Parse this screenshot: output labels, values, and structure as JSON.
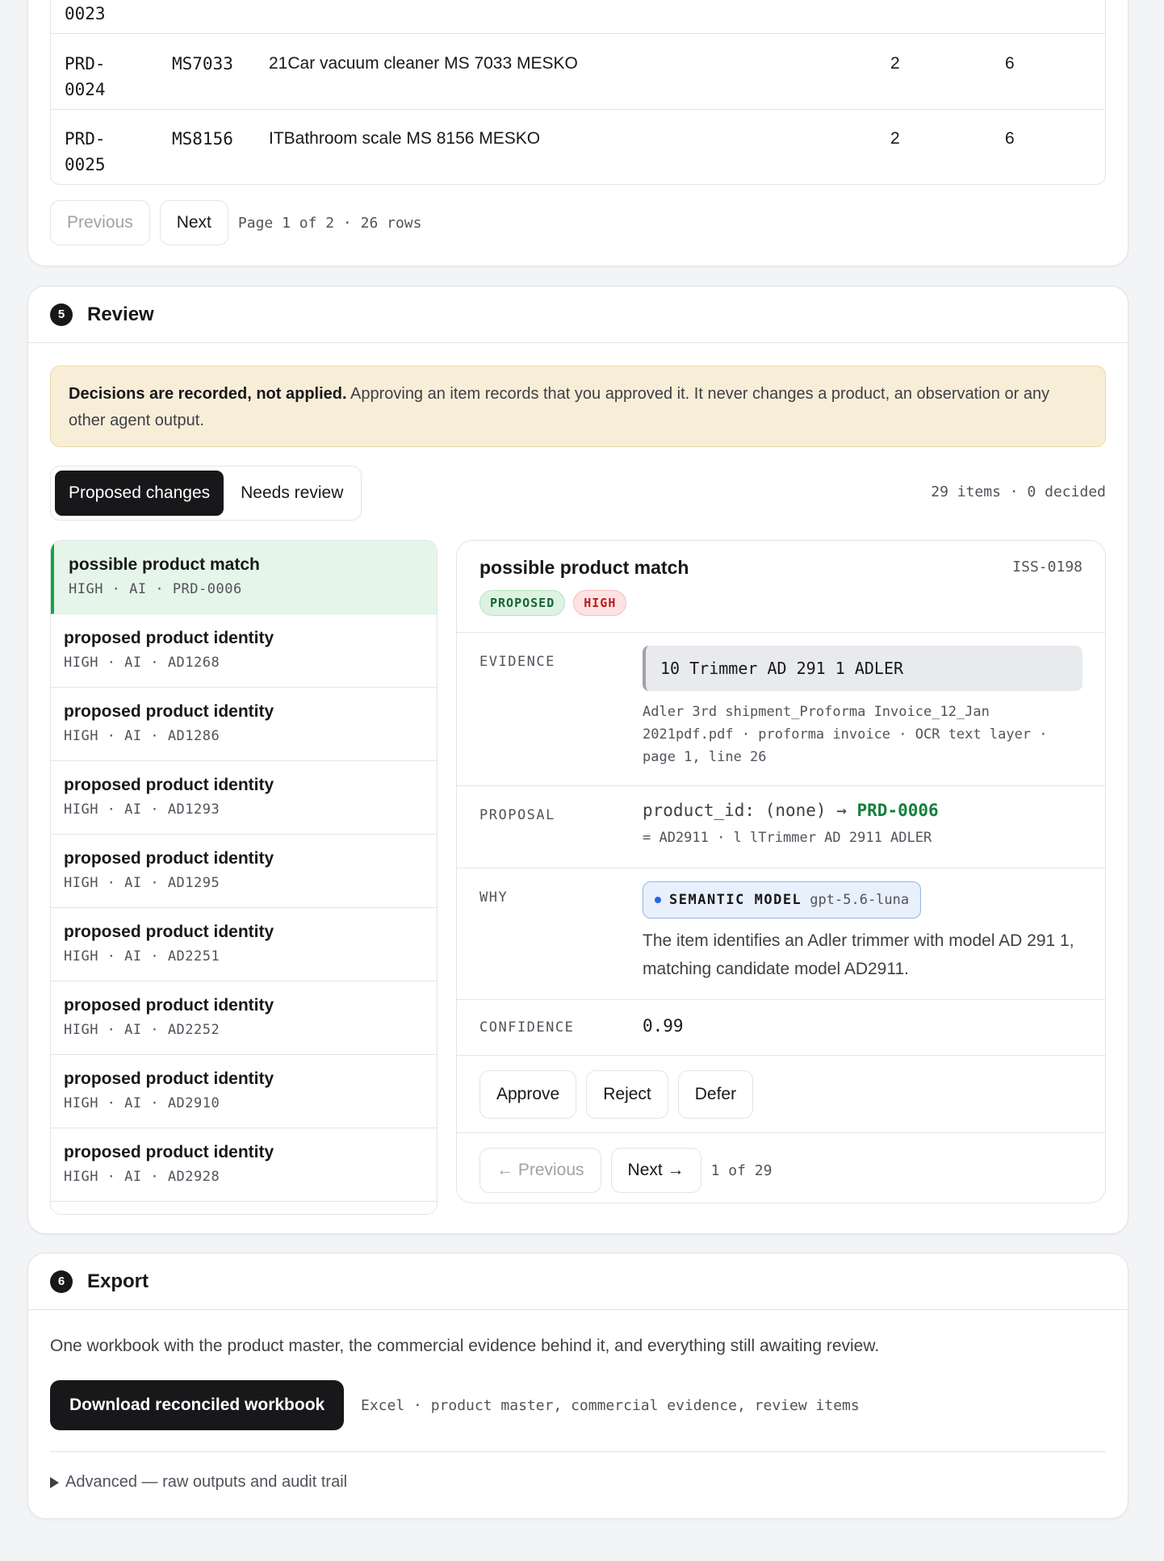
{
  "table": {
    "prev_row_id_tail": "0023",
    "rows": [
      {
        "id_prefix": "PRD-",
        "id_suffix": "0024",
        "code": "MS7033",
        "name": "21Car vacuum cleaner MS 7033 MESKO",
        "col4": "2",
        "col5": "6"
      },
      {
        "id_prefix": "PRD-",
        "id_suffix": "0025",
        "code": "MS8156",
        "name": "ITBathroom scale MS 8156 MESKO",
        "col4": "2",
        "col5": "6"
      }
    ],
    "pager": {
      "previous": "Previous",
      "next": "Next",
      "info": "Page 1 of 2 · 26 rows"
    }
  },
  "review": {
    "step": "5",
    "title": "Review",
    "notice_bold": "Decisions are recorded, not applied.",
    "notice_text": " Approving an item records that you approved it. It never changes a product, an observation or any other agent output.",
    "tabs": [
      "Proposed changes",
      "Needs review"
    ],
    "counts": "29 items · 0 decided",
    "items": [
      {
        "title": "possible product match",
        "meta": "HIGH · AI · PRD-0006"
      },
      {
        "title": "proposed product identity",
        "meta": "HIGH · AI · AD1268"
      },
      {
        "title": "proposed product identity",
        "meta": "HIGH · AI · AD1286"
      },
      {
        "title": "proposed product identity",
        "meta": "HIGH · AI · AD1293"
      },
      {
        "title": "proposed product identity",
        "meta": "HIGH · AI · AD1295"
      },
      {
        "title": "proposed product identity",
        "meta": "HIGH · AI · AD2251"
      },
      {
        "title": "proposed product identity",
        "meta": "HIGH · AI · AD2252"
      },
      {
        "title": "proposed product identity",
        "meta": "HIGH · AI · AD2910"
      },
      {
        "title": "proposed product identity",
        "meta": "HIGH · AI · AD2928"
      }
    ],
    "detail": {
      "title": "possible product match",
      "id": "ISS-0198",
      "status": "PROPOSED",
      "severity": "HIGH",
      "evidence_label": "EVIDENCE",
      "evidence_text": "10 Trimmer AD 291 1 ADLER",
      "evidence_source": "Adler 3rd shipment_Proforma Invoice_12_Jan 2021pdf.pdf · proforma invoice · OCR text layer · page 1, line 26",
      "proposal_label": "PROPOSAL",
      "proposal_field": "product_id: (none) → ",
      "proposal_new": "PRD-0006",
      "proposal_sub": "= AD2911 · l lTrimmer AD 2911 ADLER",
      "why_label": "WHY",
      "model_kind": "SEMANTIC MODEL",
      "model_name": "gpt-5.6-luna",
      "why_text": "The item identifies an Adler trimmer with model AD 291 1, matching candidate model AD2911.",
      "confidence_label": "CONFIDENCE",
      "confidence": "0.99",
      "actions": [
        "Approve",
        "Reject",
        "Defer"
      ],
      "nav": {
        "previous": "← Previous",
        "next": "Next →",
        "position": "1 of 29"
      }
    }
  },
  "export": {
    "step": "6",
    "title": "Export",
    "description": "One workbook with the product master, the commercial evidence behind it, and everything still awaiting review.",
    "download_label": "Download reconciled workbook",
    "download_meta": "Excel · product master, commercial evidence, review items",
    "advanced": "Advanced — raw outputs and audit trail"
  }
}
